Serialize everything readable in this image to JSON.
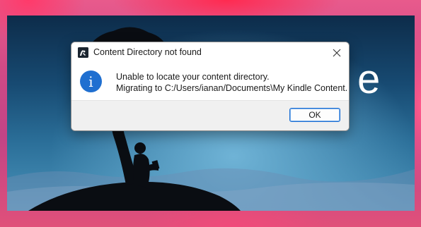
{
  "dialog": {
    "title": "Content Directory not found",
    "app_icon": "kindle-reader-icon",
    "close_icon": "close-icon",
    "info_icon": "info-icon",
    "info_glyph": "i",
    "message_line1": "Unable to locate your content directory.",
    "message_line2": "Migrating to C:/Users/ianan/Documents\\My Kindle Content.",
    "ok_label": "OK"
  },
  "splash": {
    "brand_glyph": "e"
  },
  "colors": {
    "accent": "#1f6fd0",
    "desktop_pink": "#d04a86",
    "splash_sky": "#2b6f99"
  }
}
